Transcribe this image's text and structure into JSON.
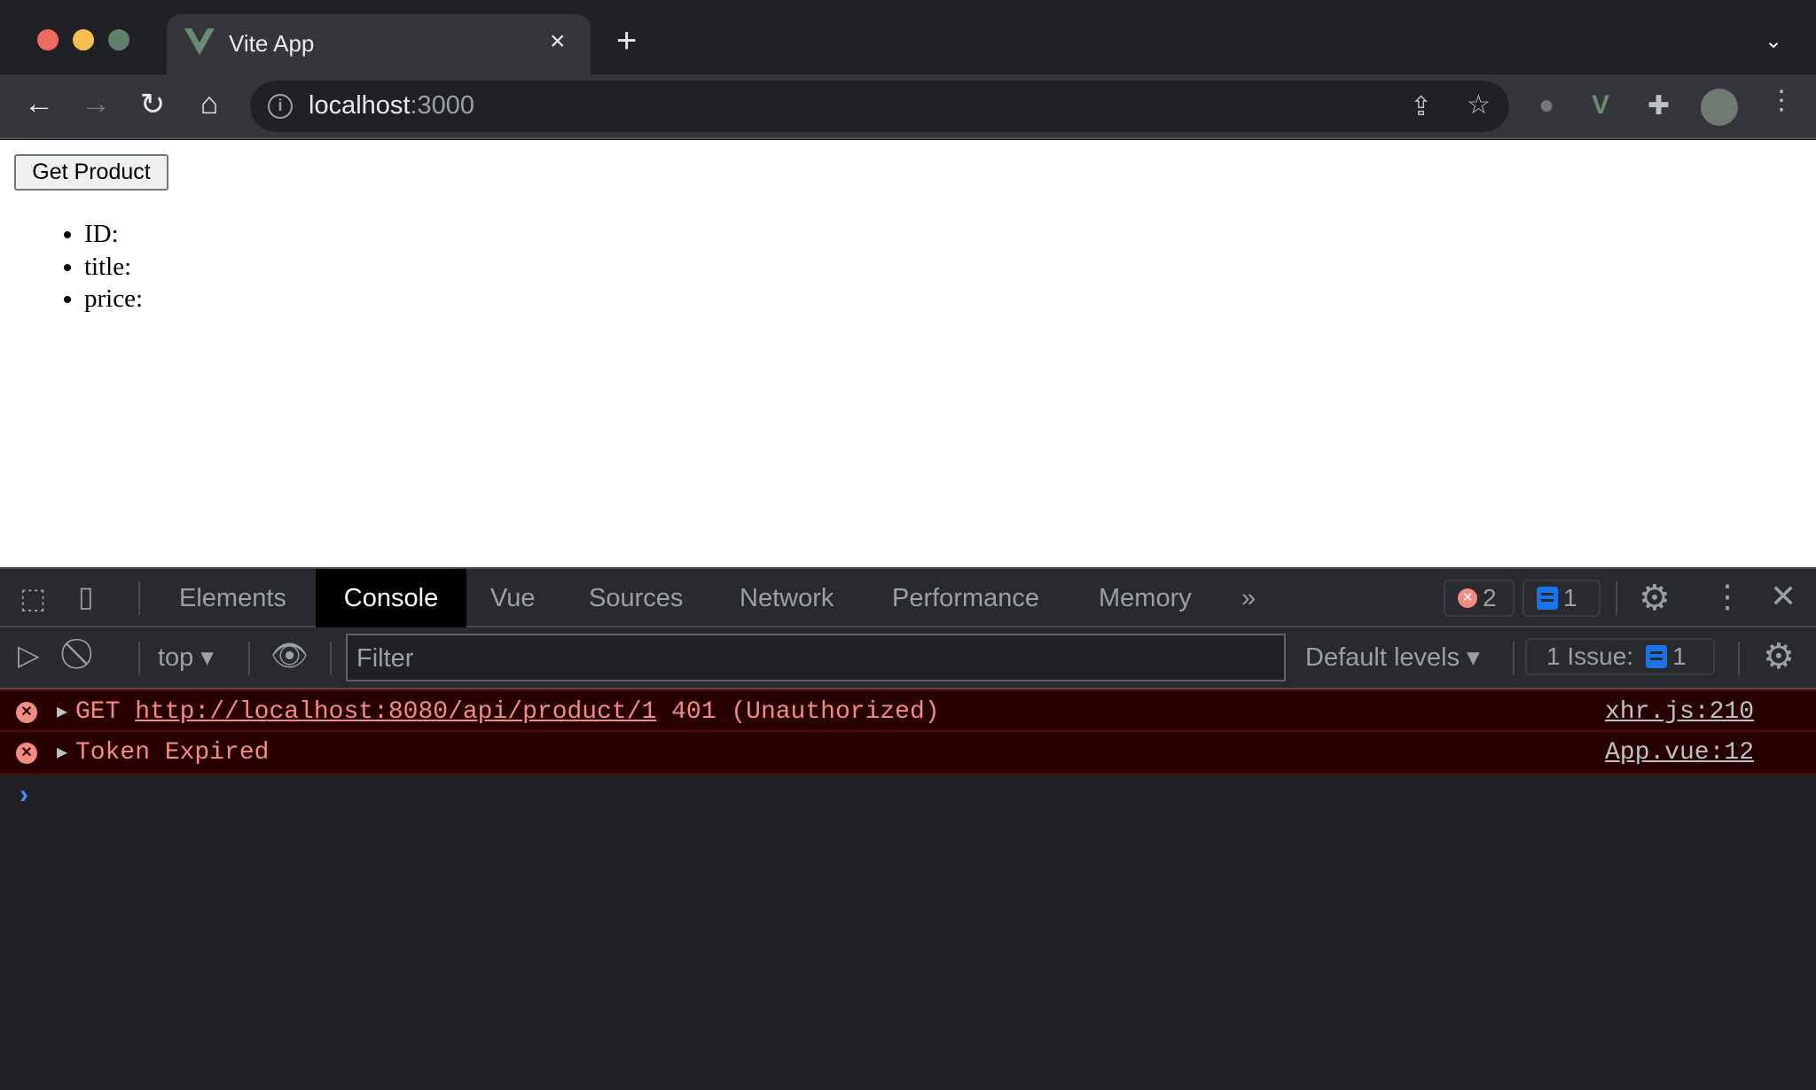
{
  "browser": {
    "tab_title": "Vite App",
    "tab_close": "×",
    "new_tab": "+",
    "url_host": "localhost",
    "url_port": ":3000"
  },
  "page": {
    "button_label": "Get Product",
    "fields": [
      "ID:",
      "title:",
      "price:"
    ]
  },
  "devtools": {
    "tabs": [
      "Elements",
      "Console",
      "Vue",
      "Sources",
      "Network",
      "Performance",
      "Memory"
    ],
    "active_tab": "Console",
    "more_tabs": "»",
    "error_count": "2",
    "message_count": "1",
    "context": "top",
    "filter_placeholder": "Filter",
    "levels": "Default levels",
    "issues_label": "1 Issue:",
    "issues_count": "1",
    "messages": [
      {
        "prefix": "GET ",
        "link": "http://localhost:8080/api/product/1",
        "suffix": " 401 (Unauthorized)",
        "source": "xhr.js:210"
      },
      {
        "prefix": "Token Expired",
        "link": "",
        "suffix": "",
        "source": "App.vue:12"
      }
    ],
    "prompt": "›"
  },
  "colors": {
    "error_bg": "#290000",
    "error_text": "#f28b82",
    "accent": "#1a73e8"
  }
}
